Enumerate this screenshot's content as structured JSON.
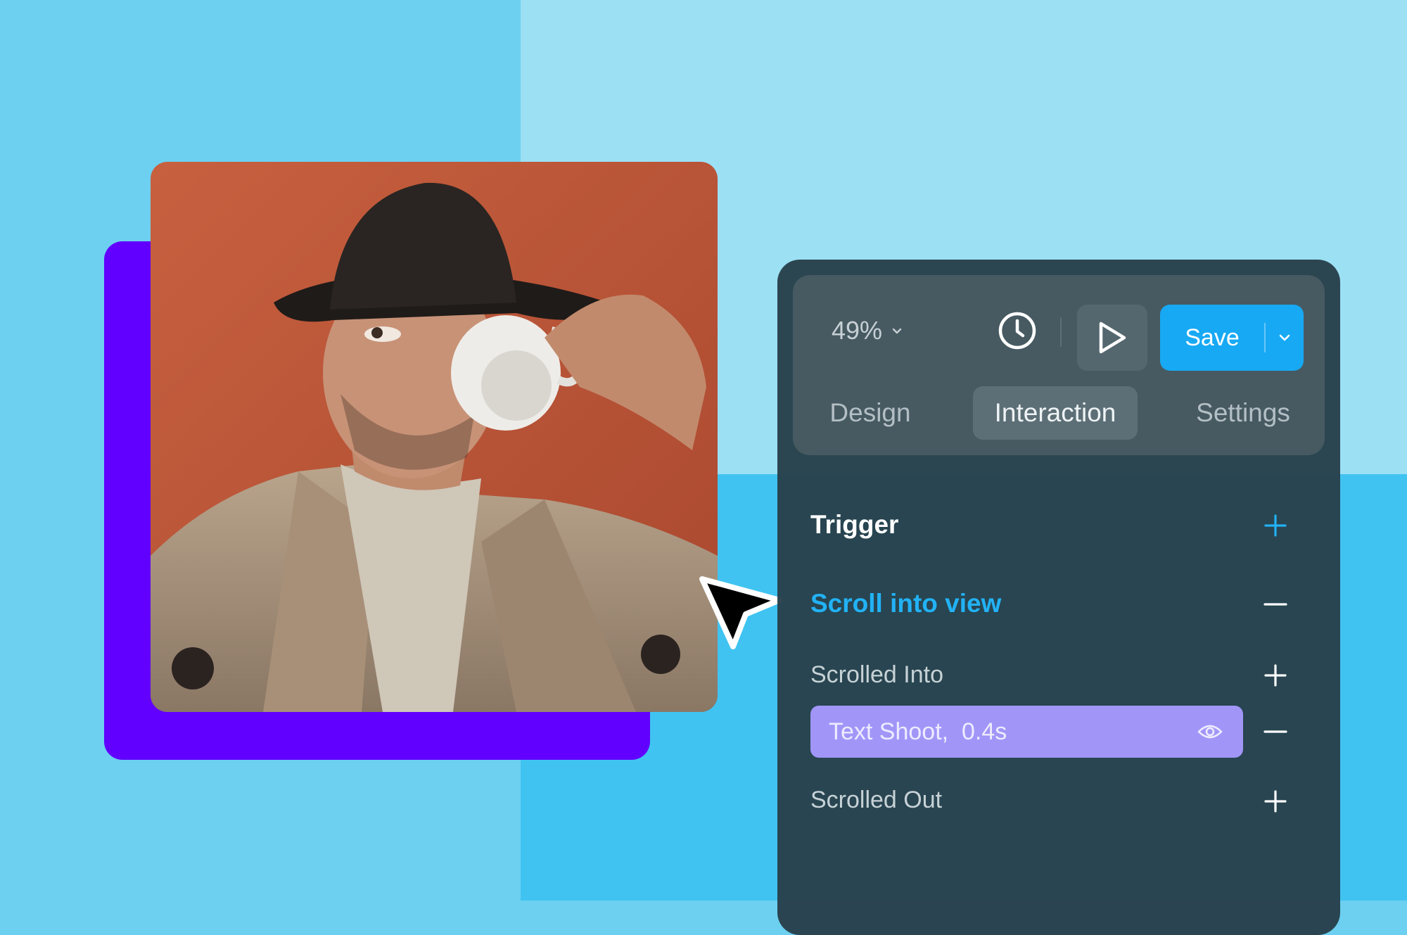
{
  "colors": {
    "background_left": "#6dd0f1",
    "background_top_right": "#9ce0f4",
    "background_bottom_right": "#40c3f1",
    "backdrop_card": "#6200ff",
    "panel": "#28404a",
    "accent": "#22b2f5",
    "save_button": "#17a9f4",
    "effect_pill": "#a196f8"
  },
  "toolbar": {
    "zoom_value": "49%",
    "zoom_icon": "chevron-down-icon",
    "history_icon": "clock-icon",
    "preview_icon": "play-icon",
    "save_label": "Save",
    "save_menu_icon": "chevron-down-icon"
  },
  "tabs": [
    {
      "label": "Design",
      "active": false
    },
    {
      "label": "Interaction",
      "active": true
    },
    {
      "label": "Settings",
      "active": false
    }
  ],
  "interaction": {
    "trigger_title": "Trigger",
    "trigger_add_icon": "plus-icon",
    "selected_trigger": "Scroll into view",
    "selected_trigger_icon": "minus-icon",
    "scrolled_into": {
      "label": "Scrolled Into",
      "add_icon": "plus-icon",
      "effect": {
        "label": "Text Shoot,  0.4s",
        "visibility_icon": "eye-icon",
        "remove_icon": "minus-icon"
      }
    },
    "scrolled_out": {
      "label": "Scrolled Out",
      "add_icon": "plus-icon"
    }
  },
  "canvas": {
    "image_subject": "photo of a man in a hat drinking from a white cup",
    "cursor_icon": "arrow-cursor-icon"
  }
}
